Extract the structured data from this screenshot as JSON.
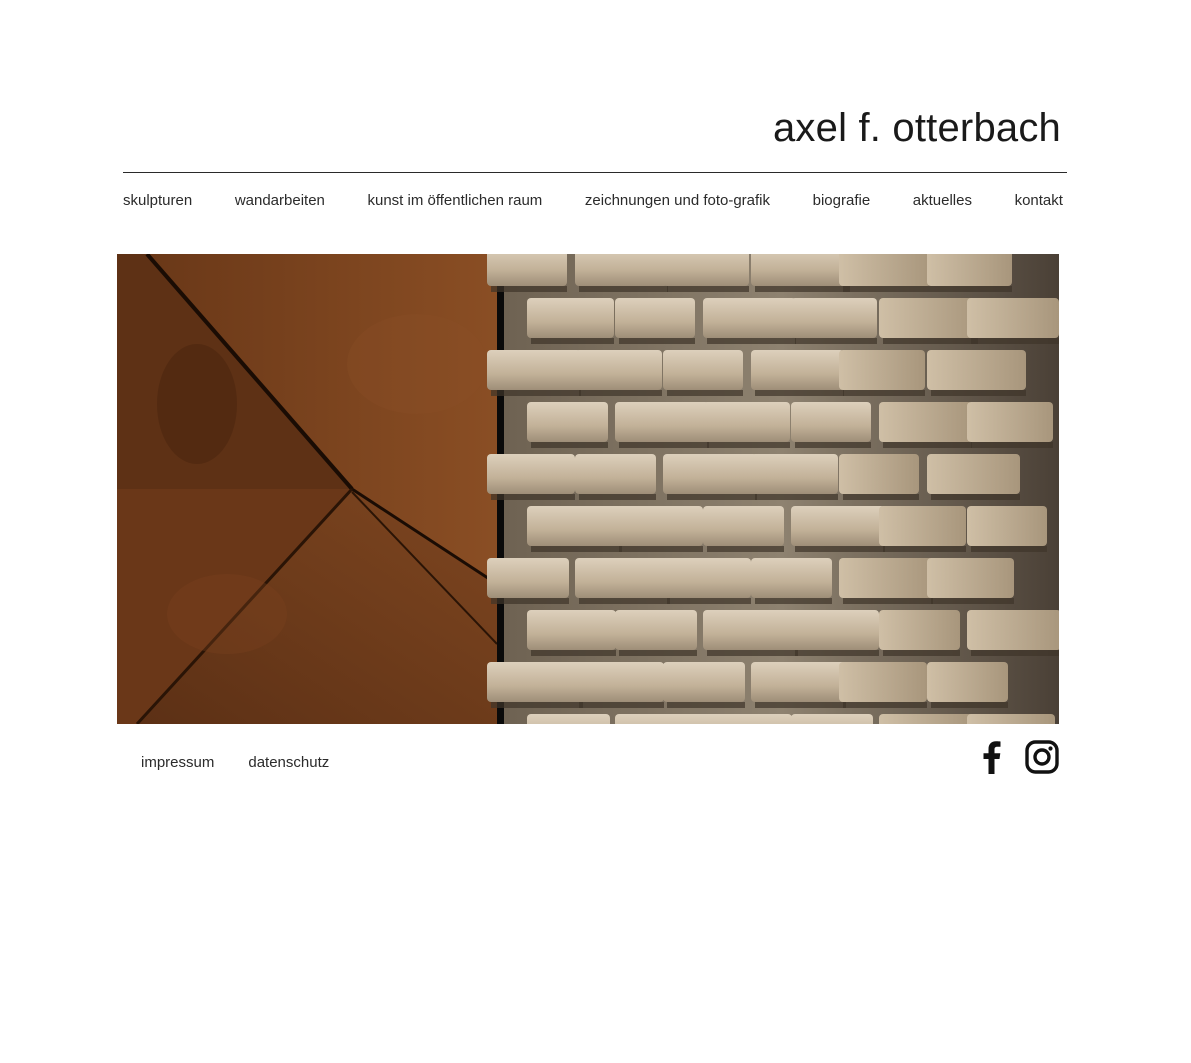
{
  "header": {
    "site_title": "axel f. otterbach"
  },
  "nav": {
    "items": [
      {
        "label": "skulpturen"
      },
      {
        "label": "wandarbeiten"
      },
      {
        "label": "kunst im öffentlichen raum"
      },
      {
        "label": "zeichnungen und foto-grafik"
      },
      {
        "label": "biografie"
      },
      {
        "label": "aktuelles"
      },
      {
        "label": "kontakt"
      }
    ]
  },
  "hero": {
    "panels": [
      {
        "name": "rusted-steel-panel",
        "colors": [
          "#5a2f14",
          "#7a4420",
          "#3a1d0c"
        ]
      },
      {
        "name": "stone-relief-panel",
        "colors": [
          "#c8b8a0",
          "#8a7a66",
          "#5a4e42"
        ]
      }
    ]
  },
  "footer": {
    "links": [
      {
        "label": "impressum"
      },
      {
        "label": "datenschutz"
      }
    ],
    "social": [
      {
        "icon": "facebook-icon"
      },
      {
        "icon": "instagram-icon"
      }
    ]
  },
  "colors": {
    "text": "#1a1a1a",
    "rule": "#2a2a2a",
    "background": "#ffffff"
  }
}
